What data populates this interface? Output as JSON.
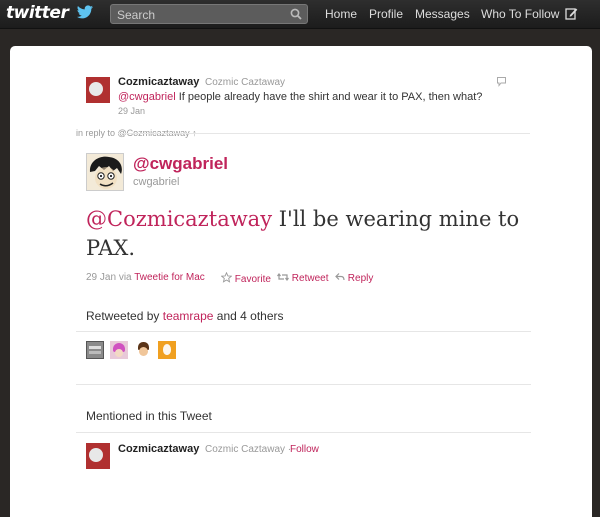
{
  "topbar": {
    "logo_text": "twitter",
    "search_placeholder": "Search",
    "nav": [
      "Home",
      "Profile",
      "Messages",
      "Who To Follow"
    ],
    "icons": {
      "search": "magnifier-icon",
      "compose": "compose-icon",
      "logo_bird": "bird-icon"
    }
  },
  "original_tweet": {
    "screen_name": "Cozmicaztaway",
    "real_name": "Cozmic Caztaway",
    "mention": "@cwgabriel",
    "text": " If people already have the shirt and wear it to PAX, then what?",
    "time": "29 Jan"
  },
  "in_reply_to": "in reply to @Cozmicaztaway ↑",
  "main_tweet": {
    "handle": "@cwgabriel",
    "username": "cwgabriel",
    "mention": "@Cozmicaztaway",
    "text": " I'll be wearing mine to PAX.",
    "time": "29 Jan",
    "via_label": "via",
    "client": "Tweetie for Mac",
    "favorite_label": "Favorite",
    "retweet_label": "Retweet",
    "reply_label": "Reply"
  },
  "retweets": {
    "prefix": "Retweeted by",
    "user": "teamrape",
    "suffix": "and 4 others"
  },
  "mentioned": {
    "heading": "Mentioned in this Tweet",
    "screen_name": "Cozmicaztaway",
    "real_name": "Cozmic Caztaway ·",
    "follow_label": "Follow"
  },
  "colors": {
    "link": "#c0245b",
    "topbar": "#1c1c1c",
    "background": "#2a2725"
  }
}
